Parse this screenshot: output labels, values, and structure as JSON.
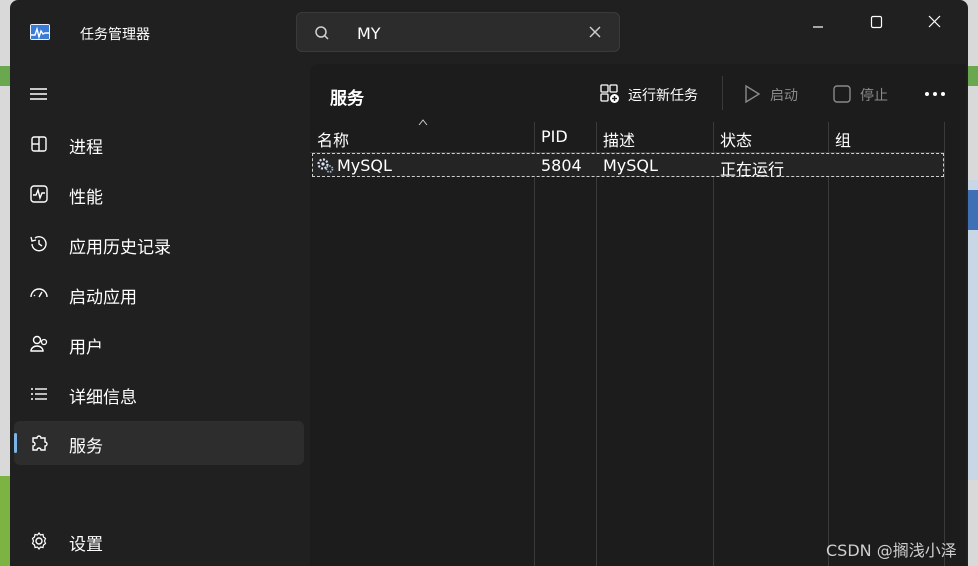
{
  "window": {
    "title": "任务管理器"
  },
  "search": {
    "value": "MY"
  },
  "sidebar": {
    "items": [
      {
        "label": "进程",
        "icon": "processes-icon"
      },
      {
        "label": "性能",
        "icon": "performance-icon"
      },
      {
        "label": "应用历史记录",
        "icon": "app-history-icon"
      },
      {
        "label": "启动应用",
        "icon": "startup-apps-icon"
      },
      {
        "label": "用户",
        "icon": "users-icon"
      },
      {
        "label": "详细信息",
        "icon": "details-icon"
      },
      {
        "label": "服务",
        "icon": "services-icon",
        "active": true
      }
    ],
    "settings": {
      "label": "设置",
      "icon": "gear-icon"
    }
  },
  "main": {
    "title": "服务",
    "toolbar": {
      "run_new_task": "运行新任务",
      "start": "启动",
      "stop": "停止"
    },
    "table": {
      "columns": [
        "名称",
        "PID",
        "描述",
        "状态",
        "组"
      ],
      "rows": [
        {
          "name": "MySQL",
          "pid": "5804",
          "description": "MySQL",
          "status": "正在运行",
          "group": ""
        }
      ]
    }
  },
  "watermark": "CSDN @搁浅小泽",
  "colors": {
    "accent": "#7ab5e8",
    "window_bg": "#202020",
    "panel_bg": "#1c1c1c"
  }
}
